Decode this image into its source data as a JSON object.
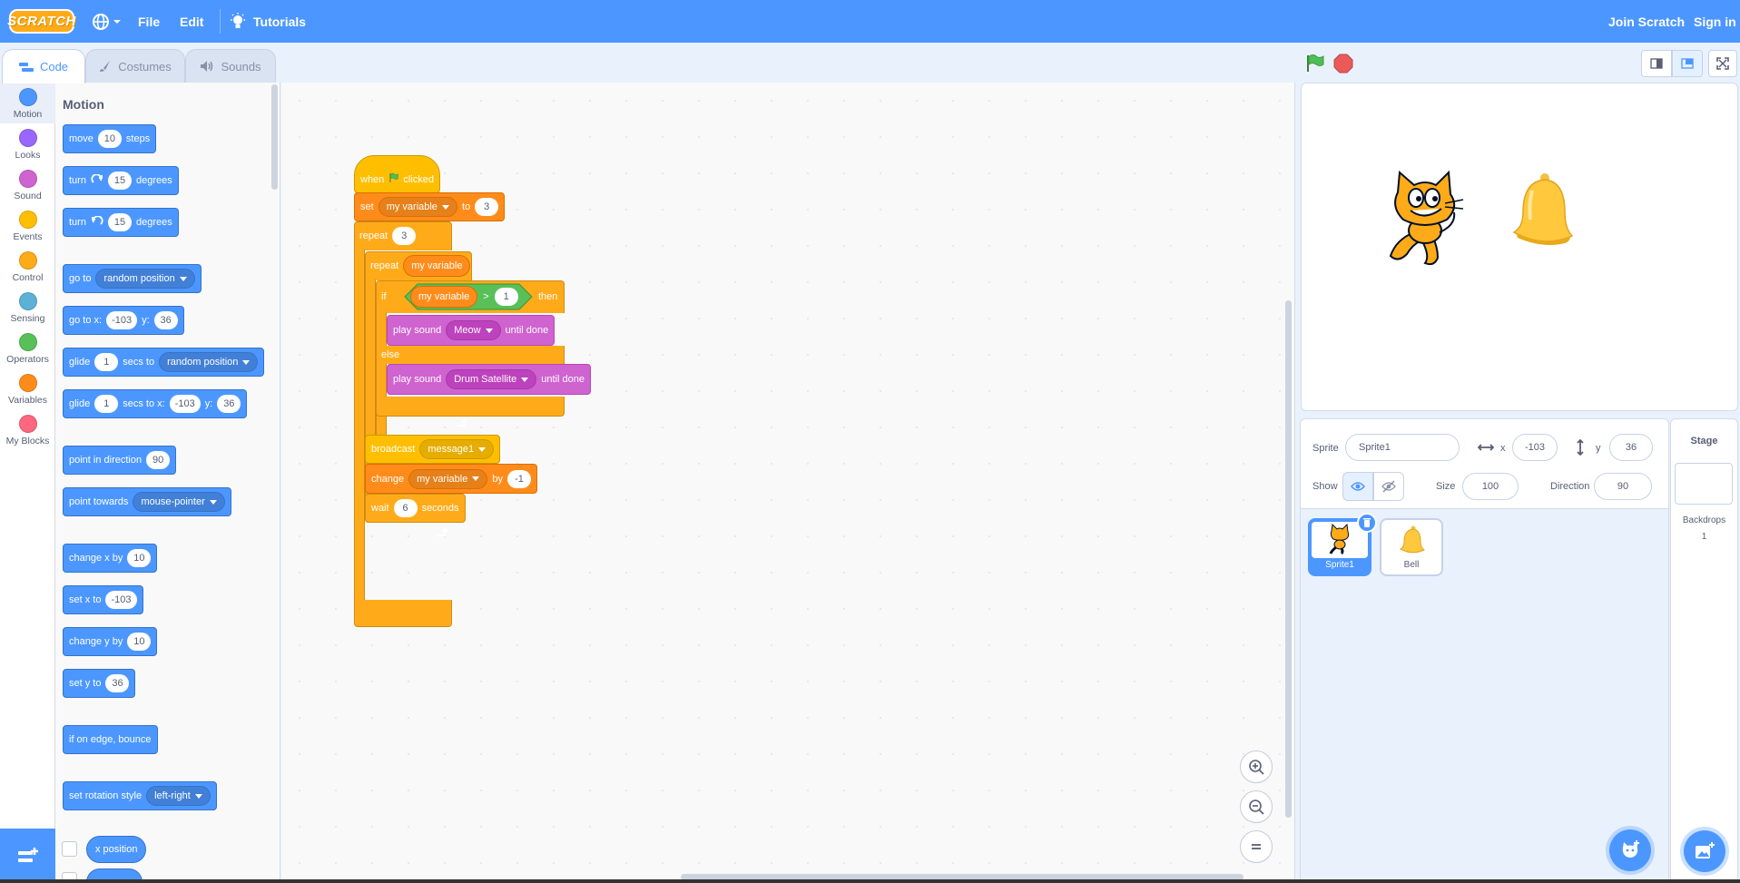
{
  "menubar": {
    "logo": "SCRATCH",
    "file": "File",
    "edit": "Edit",
    "tutorials": "Tutorials",
    "join": "Join Scratch",
    "signin": "Sign in"
  },
  "tabs": {
    "code": "Code",
    "costumes": "Costumes",
    "sounds": "Sounds"
  },
  "categories": [
    {
      "label": "Motion",
      "color": "#4c97ff"
    },
    {
      "label": "Looks",
      "color": "#9966ff"
    },
    {
      "label": "Sound",
      "color": "#cf63cf"
    },
    {
      "label": "Events",
      "color": "#ffbf00"
    },
    {
      "label": "Control",
      "color": "#ffab19"
    },
    {
      "label": "Sensing",
      "color": "#5cb1d6"
    },
    {
      "label": "Operators",
      "color": "#59c059"
    },
    {
      "label": "Variables",
      "color": "#ff8c1a"
    },
    {
      "label": "My Blocks",
      "color": "#ff6680"
    }
  ],
  "flyout": {
    "title": "Motion",
    "move": {
      "a": "move",
      "n": "10",
      "b": "steps"
    },
    "turn_right": {
      "a": "turn",
      "n": "15",
      "b": "degrees"
    },
    "turn_left": {
      "a": "turn",
      "n": "15",
      "b": "degrees"
    },
    "goto": {
      "a": "go to",
      "d": "random position"
    },
    "goto_xy": {
      "a": "go to x:",
      "x": "-103",
      "b": "y:",
      "y": "36"
    },
    "glide": {
      "a": "glide",
      "n": "1",
      "b": "secs to",
      "d": "random position"
    },
    "glide_xy": {
      "a": "glide",
      "n": "1",
      "b": "secs to x:",
      "x": "-103",
      "c": "y:",
      "y": "36"
    },
    "point_dir": {
      "a": "point in direction",
      "n": "90"
    },
    "point_towards": {
      "a": "point towards",
      "d": "mouse-pointer"
    },
    "change_x": {
      "a": "change x by",
      "n": "10"
    },
    "set_x": {
      "a": "set x to",
      "n": "-103"
    },
    "change_y": {
      "a": "change y by",
      "n": "10"
    },
    "set_y": {
      "a": "set y to",
      "n": "36"
    },
    "bounce": "if on edge, bounce",
    "rotation": {
      "a": "set rotation style",
      "d": "left-right"
    },
    "x_position": "x position"
  },
  "script": {
    "when": "when",
    "clicked": "clicked",
    "set": "set",
    "set_var": "my variable",
    "to": "to",
    "set_val": "3",
    "repeat": "repeat",
    "repeat_n": "3",
    "repeat2": "repeat",
    "repeat2_var": "my variable",
    "if": "if",
    "cond_var": "my variable",
    "cond_op": ">",
    "cond_val": "1",
    "then": "then",
    "play1": "play sound",
    "play1_sound": "Meow",
    "until1": "until done",
    "else": "else",
    "play2": "play sound",
    "play2_sound": "Drum Satellite",
    "until2": "until done",
    "broadcast": "broadcast",
    "message": "message1",
    "change": "change",
    "change_var": "my variable",
    "by": "by",
    "change_val": "-1",
    "wait": "wait",
    "wait_val": "6",
    "seconds": "seconds"
  },
  "sprite_info": {
    "sprite_label": "Sprite",
    "sprite_name": "Sprite1",
    "x_label": "x",
    "x": "-103",
    "y_label": "y",
    "y": "36",
    "show_label": "Show",
    "size_label": "Size",
    "size": "100",
    "direction_label": "Direction",
    "direction": "90"
  },
  "sprites": [
    {
      "name": "Sprite1"
    },
    {
      "name": "Bell"
    }
  ],
  "stage_panel": {
    "title": "Stage",
    "backdrops_label": "Backdrops",
    "backdrops_count": "1"
  }
}
